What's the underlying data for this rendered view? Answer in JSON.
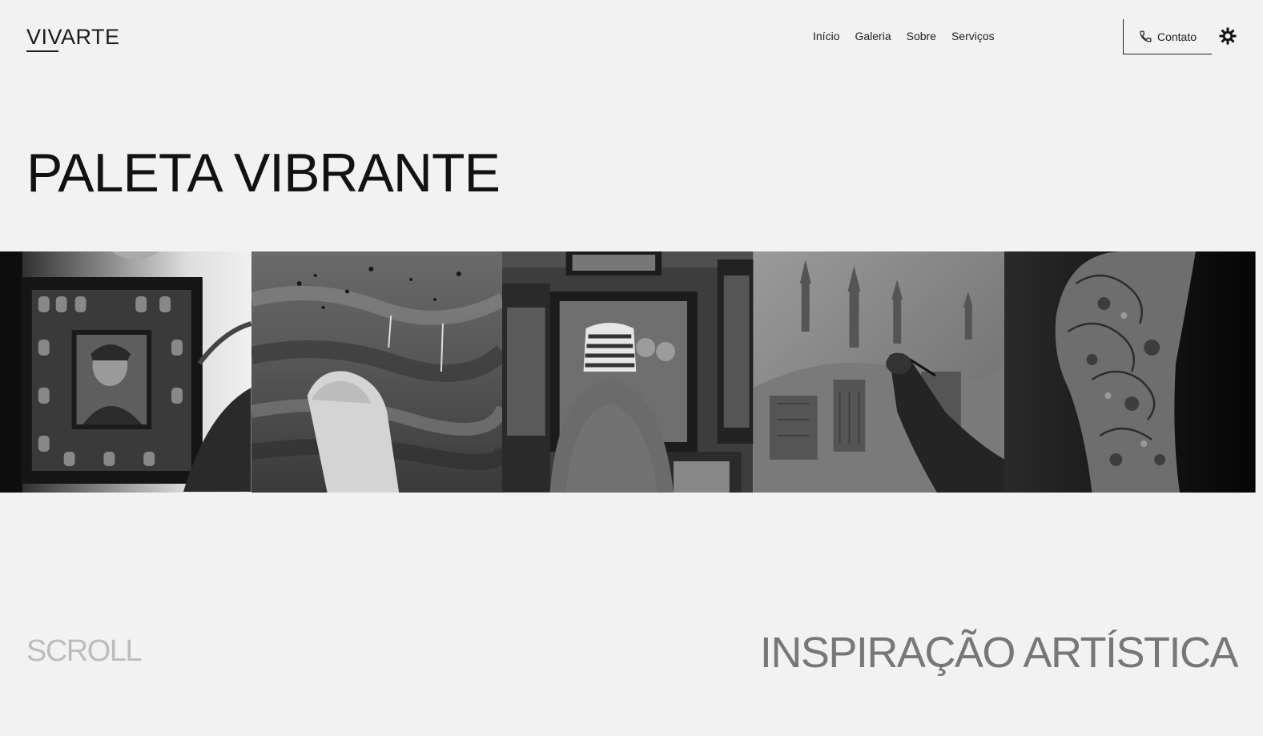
{
  "header": {
    "logo": "VIVARTE",
    "nav": [
      "Início",
      "Galeria",
      "Sobre",
      "Serviços"
    ],
    "contact_label": "Contato",
    "contact_icon": "phone-icon",
    "theme_icon": "sun-gear-icon"
  },
  "hero": {
    "title": "PALETA VIBRANTE"
  },
  "gallery": {
    "images": [
      "framed-portrait-photo",
      "abstract-painting-hand-photo",
      "gallery-visitor-photo",
      "city-painting-hand-photo",
      "tattooed-arm-photo"
    ]
  },
  "footer": {
    "scroll_label": "SCROLL",
    "tagline": "INSPIRAÇÃO ARTÍSTICA"
  },
  "colors": {
    "background": "#f2f2f2",
    "text": "#151515",
    "muted": "#bdbdbd",
    "tagline": "#777777"
  }
}
